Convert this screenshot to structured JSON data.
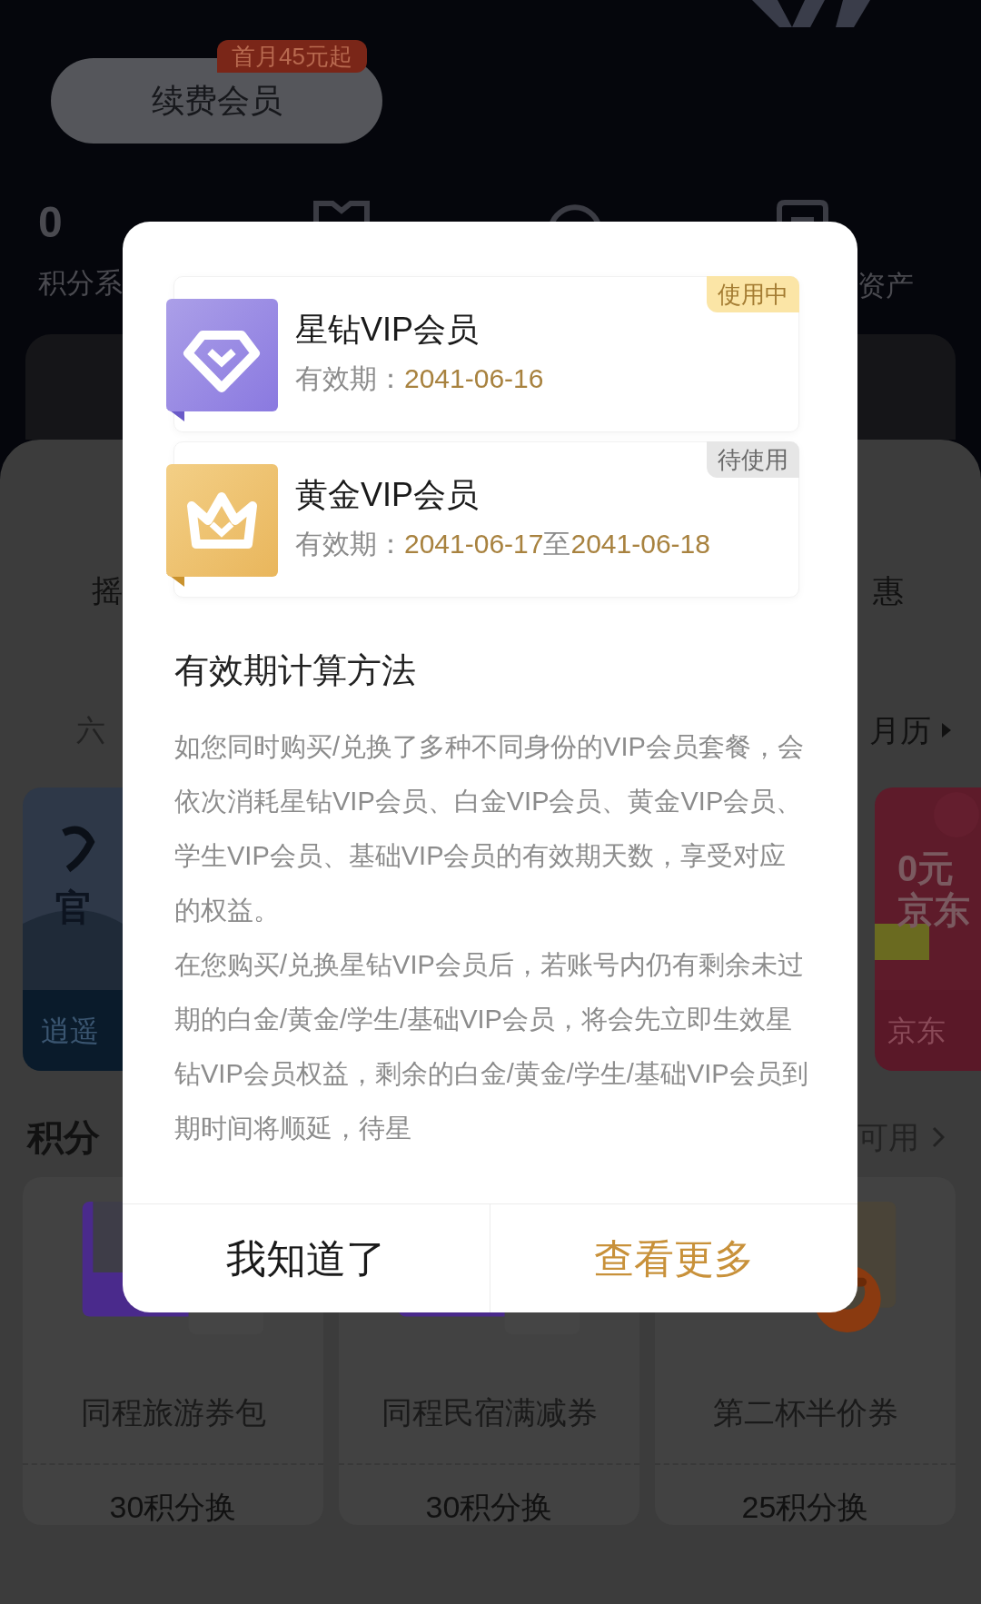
{
  "background": {
    "renew_button": "续费会员",
    "renew_badge": "首月45元起",
    "points_value": "0",
    "stat_labels": [
      "积分系",
      "资产"
    ],
    "activity_labels": [
      "摇",
      "惠"
    ],
    "calendar_left": "六",
    "calendar_link": "月历",
    "banners": [
      {
        "texts": [
          "官"
        ],
        "footer": "逍遥",
        "color": "#0a1b2b"
      },
      {
        "texts": [
          "0元",
          "京东"
        ],
        "footer": "京东",
        "color": "#5a1828"
      }
    ],
    "section_title": "积分",
    "section_link": "可用",
    "products": [
      {
        "name": "同程旅游券包",
        "price": "30积分换",
        "kind": "ticket"
      },
      {
        "name": "同程民宿满减券",
        "price": "30积分换",
        "kind": "ticket"
      },
      {
        "name": "第二杯半价券",
        "price": "25积分换",
        "kind": "coffee"
      }
    ]
  },
  "dialog": {
    "memberships": [
      {
        "name": "星钻VIP会员",
        "validity_label": "有效期：",
        "validity": "2041-06-16",
        "status": "使用中",
        "in_use": true,
        "kind": "diamond"
      },
      {
        "name": "黄金VIP会员",
        "validity_label": "有效期：",
        "validity": "2041-06-17",
        "separator": "至",
        "validity_end": "2041-06-18",
        "status": "待使用",
        "in_use": false,
        "kind": "crown"
      }
    ],
    "heading": "有效期计算方法",
    "paragraphs": [
      "如您同时购买/兑换了多种不同身份的VIP会员套餐，会依次消耗星钻VIP会员、白金VIP会员、黄金VIP会员、学生VIP会员、基础VIP会员的有效期天数，享受对应的权益。",
      "在您购买/兑换星钻VIP会员后，若账号内仍有剩余未过期的白金/黄金/学生/基础VIP会员，将会先立即生效星钻VIP会员权益，剩余的白金/黄金/学生/基础VIP会员到期时间将顺延，待星"
    ],
    "buttons": [
      {
        "label": "我知道了",
        "primary": false
      },
      {
        "label": "查看更多",
        "primary": true
      }
    ]
  }
}
